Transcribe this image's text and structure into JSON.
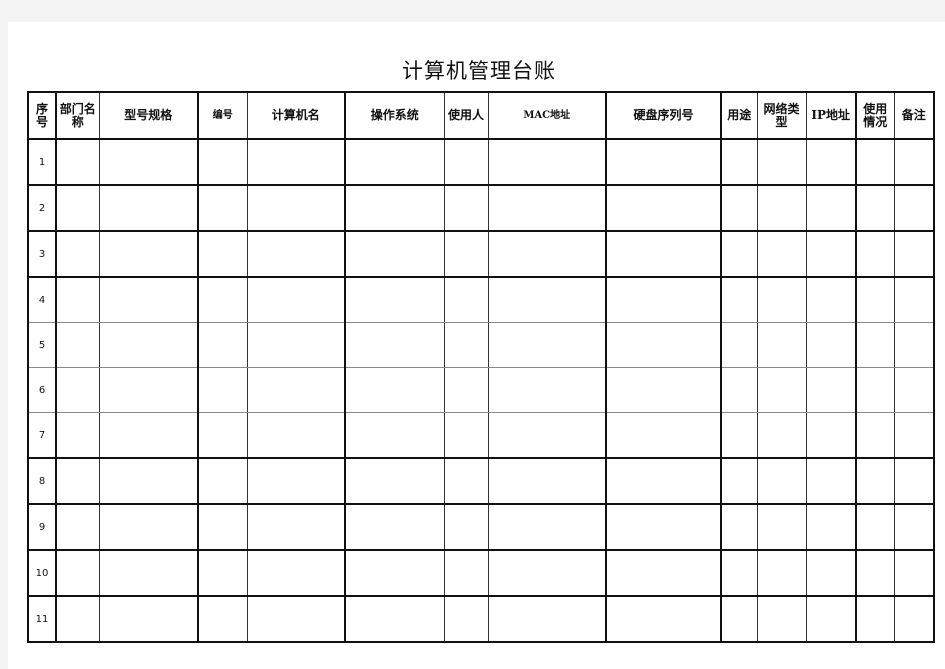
{
  "document": {
    "title": "计算机管理台账",
    "columns": [
      {
        "key": "seq",
        "label": "序号"
      },
      {
        "key": "dept",
        "label": "部门名称"
      },
      {
        "key": "model",
        "label": "型号规格"
      },
      {
        "key": "number",
        "label": "编号"
      },
      {
        "key": "hostname",
        "label": "计算机名"
      },
      {
        "key": "os",
        "label": "操作系统"
      },
      {
        "key": "user",
        "label": "使用人"
      },
      {
        "key": "mac",
        "label": "MAC地址"
      },
      {
        "key": "disk_serial",
        "label": "硬盘序列号"
      },
      {
        "key": "purpose",
        "label": "用途"
      },
      {
        "key": "network_type",
        "label": "网络类型"
      },
      {
        "key": "ip",
        "label": "IP地址"
      },
      {
        "key": "usage_status",
        "label": "使用情况"
      },
      {
        "key": "remarks",
        "label": "备注"
      }
    ],
    "rows": [
      {
        "seq": "1"
      },
      {
        "seq": "2"
      },
      {
        "seq": "3"
      },
      {
        "seq": "4"
      },
      {
        "seq": "5"
      },
      {
        "seq": "6"
      },
      {
        "seq": "7"
      },
      {
        "seq": "8"
      },
      {
        "seq": "9"
      },
      {
        "seq": "10"
      },
      {
        "seq": "11"
      }
    ]
  }
}
